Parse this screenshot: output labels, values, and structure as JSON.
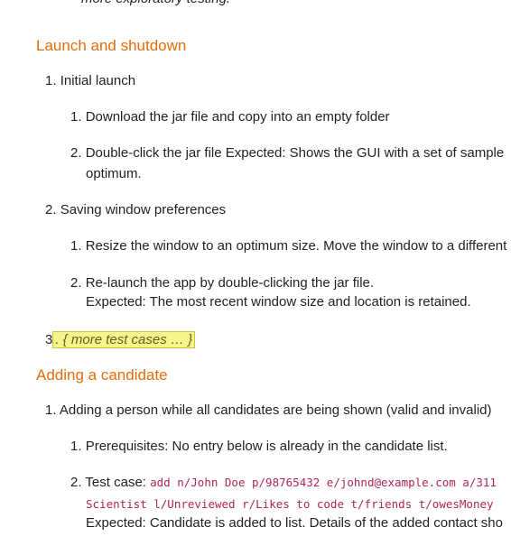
{
  "top_fragment": "more exploratory testing.",
  "section1": {
    "heading": "Launch and shutdown",
    "item1": {
      "number": "1.",
      "label": "Initial launch",
      "sub1": {
        "number": "1.",
        "text": "Download the jar file and copy into an empty folder"
      },
      "sub2": {
        "number": "2.",
        "text": "Double-click the jar file Expected: Shows the GUI with a set of sample",
        "text_cont": "optimum."
      }
    },
    "item2": {
      "number": "2.",
      "label": "Saving window preferences",
      "sub1": {
        "number": "1.",
        "text": "Resize the window to an optimum size. Move the window to a different"
      },
      "sub2": {
        "number": "2.",
        "text": "Re-launch the app by double-clicking the jar file.",
        "text_cont": "Expected: The most recent window size and location is retained."
      }
    },
    "item3": {
      "number": "3",
      "text": ". { more test cases … }"
    }
  },
  "section2": {
    "heading": "Adding a candidate",
    "item1": {
      "number": "1.",
      "label": "Adding a person while all candidates are being shown (valid and invalid)",
      "sub1": {
        "number": "1.",
        "text": "Prerequisites: No entry below is already in the candidate list."
      },
      "sub2": {
        "number": "2.",
        "prefix": "Test case:",
        "code1": "add n/John Doe p/98765432 e/johnd@example.com a/311",
        "code2": "Scientist l/Unreviewed r/Likes to code t/friends t/owesMoney",
        "expected": "Expected: Candidate is added to list. Details of the added contact sho"
      }
    }
  }
}
